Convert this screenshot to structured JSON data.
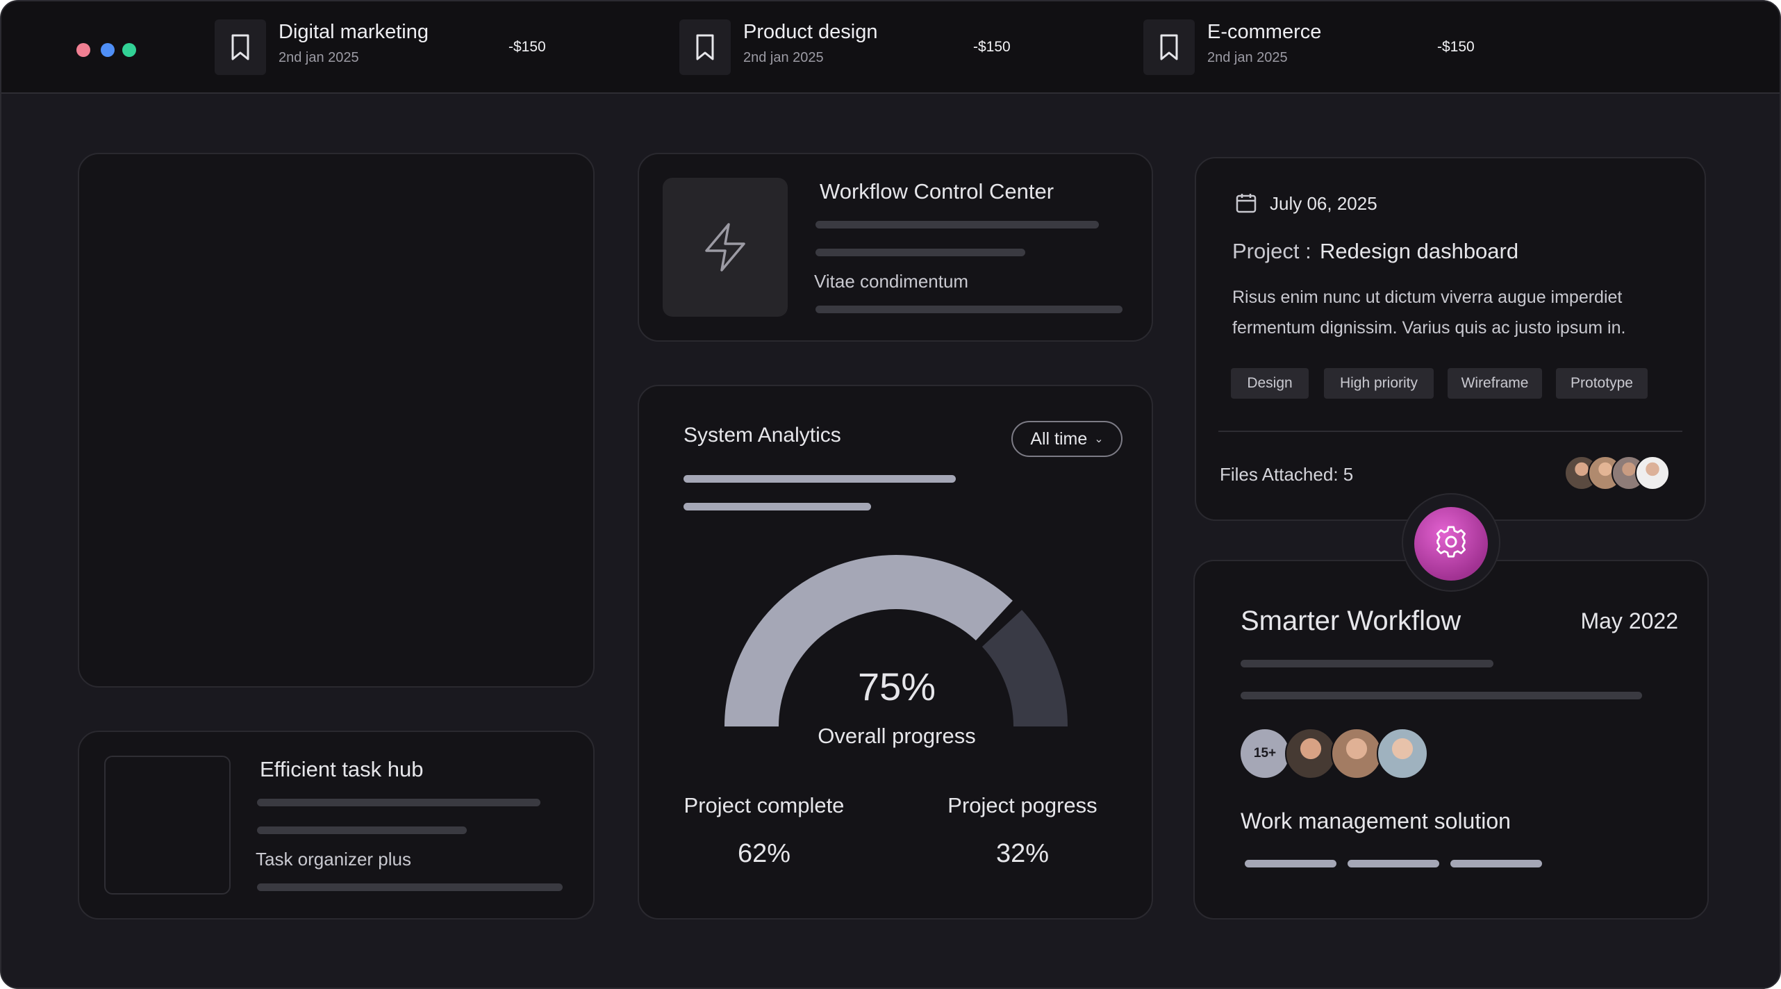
{
  "window": {
    "dots": [
      "#f07f92",
      "#4f8ff7",
      "#32d296"
    ]
  },
  "transactions": [
    {
      "title": "Digital marketing",
      "date": "2nd jan 2025",
      "amount": "-$150",
      "icon": "bookmark-icon"
    },
    {
      "title": "Product design",
      "date": "2nd jan 2025",
      "amount": "-$150",
      "icon": "bookmark-icon"
    },
    {
      "title": "E-commerce",
      "date": "2nd jan 2025",
      "amount": "-$150",
      "icon": "bookmark-icon"
    }
  ],
  "workflow": {
    "title": "Workflow Control Center",
    "subtitle": "Vitae condimentum",
    "icon": "lightning-icon"
  },
  "taskhub": {
    "title": "Efficient task hub",
    "subtitle": "Task organizer plus"
  },
  "analytics": {
    "title": "System Analytics",
    "filter": "All time",
    "gauge_value": "75%",
    "gauge_fraction": 0.75,
    "gauge_label": "Overall progress",
    "stats": [
      {
        "label": "Project complete",
        "value": "62%"
      },
      {
        "label": "Project pogress",
        "value": "32%"
      }
    ],
    "colors": {
      "filled": "#a5a7b6",
      "track": "#393a45"
    }
  },
  "project": {
    "date": "July 06, 2025",
    "label": "Project :",
    "name": "Redesign dashboard",
    "description_line1": "Risus enim nunc ut dictum viverra augue imperdiet",
    "description_line2": "fermentum dignissim. Varius quis ac justo ipsum in.",
    "tags": [
      "Design",
      "High priority",
      "Wireframe",
      "Prototype"
    ],
    "files": "Files Attached: 5",
    "icon": "calendar-icon"
  },
  "smarter": {
    "title": "Smarter Workflow",
    "date": "May 2022",
    "count_badge": "15+",
    "subtitle": "Work management solution",
    "icon": "gear-icon",
    "accent": "#c03fb2"
  }
}
